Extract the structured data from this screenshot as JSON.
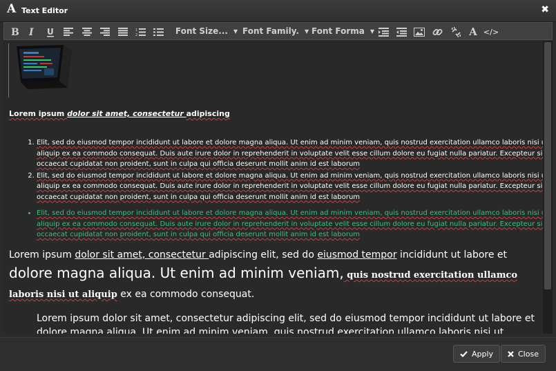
{
  "window": {
    "title": "Text Editor",
    "title_icon": "A",
    "close_glyph": "✖"
  },
  "toolbar": {
    "font_size_label": "Font Size...",
    "font_family_label": "Font Family.",
    "font_format_label": "Font Forma",
    "text_color_glyph": "A",
    "source_glyph": "</>"
  },
  "content": {
    "heading": {
      "part1": "Lorem ipsum ",
      "part2": "dolor sit amet, consectetur ",
      "part3": "adipiscing"
    },
    "ordered_items": [
      "Elit, sed do eiusmod tempor incididunt ut labore et dolore magna aliqua. Ut enim ad minim veniam, quis nostrud exercitation ullamco laboris nisi ut aliquip ex ea commodo consequat. Duis aute irure dolor in reprehenderit in voluptate velit esse cillum dolore eu fugiat nulla pariatur. Excepteur sint occaecat cupidatat non proident, sunt in culpa qui officia deserunt mollit anim id est laborum",
      "Elit, sed do eiusmod tempor incididunt ut labore et dolore magna aliqua. Ut enim ad minim veniam, quis nostrud exercitation ullamco laboris nisi ut aliquip ex ea commodo consequat. Duis aute irure dolor in reprehenderit in voluptate velit esse cillum dolore eu fugiat nulla pariatur. Excepteur sint occaecat cupidatat non proident, sunt in culpa qui officia deserunt mollit anim id est laborum"
    ],
    "bullet_item": "Elit, sed do eiusmod tempor incididunt ut labore et dolore magna aliqua. Ut enim ad minim veniam, quis nostrud exercitation ullamco laboris nisi ut aliquip ex ea commodo consequat. Duis aute irure dolor in reprehenderit in voluptate velit esse cillum dolore eu fugiat nulla pariatur. Excepteur sint occaecat cupidatat non proident, sunt in culpa qui officia deserunt mollit anim id est laborum",
    "para": {
      "p1": "Lorem ipsum ",
      "p2": "dolor sit amet, consectetur ",
      "p3": "adipiscing elit, sed do ",
      "p4": "eiusmod tempor",
      "p5": " incididunt ut labore et",
      "p6": "dolore magna aliqua. Ut enim ad minim veniam,",
      "p7": " quis nostrud exercitation ullamco laboris nisi ut aliquip",
      "p8": " ex ea commodo consequat."
    },
    "blockquote": "Lorem ipsum dolor sit amet, consectetur adipiscing elit, sed do eiusmod tempor incididunt ut labore et dolore magna aliqua. Ut enim ad minim veniam, quis nostrud exercitation ullamco laboris nisi ut"
  },
  "footer": {
    "apply_label": "Apply",
    "close_label": "Close"
  },
  "colors": {
    "bullet_text": "#3fbf7f",
    "editor_bg": "#292929",
    "accent": "#ffffff"
  }
}
